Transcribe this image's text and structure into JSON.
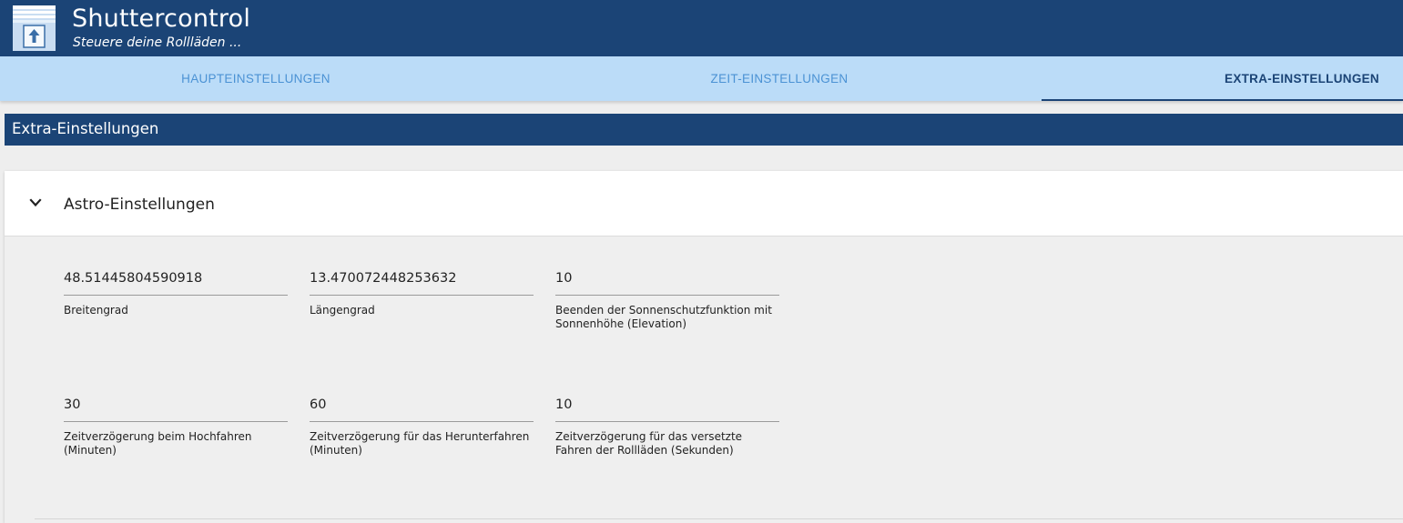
{
  "header": {
    "title": "Shuttercontrol",
    "subtitle": "Steuere deine Rollläden ..."
  },
  "tabs": [
    {
      "label": "HAUPTEINSTELLUNGEN",
      "active": false
    },
    {
      "label": "ZEIT-EINSTELLUNGEN",
      "active": false
    },
    {
      "label": "EXTRA-EINSTELLUNGEN",
      "active": true
    }
  ],
  "section": {
    "title": "Extra-Einstellungen"
  },
  "panel": {
    "title": "Astro-Einstellungen",
    "expanded": true,
    "fields": [
      {
        "value": "48.51445804590918",
        "label": "Breitengrad"
      },
      {
        "value": "13.470072448253632",
        "label": "Längengrad"
      },
      {
        "value": "10",
        "label": "Beenden der Sonnenschutzfunktion mit Sonnenhöhe (Elevation)"
      },
      {
        "value": "30",
        "label": "Zeitverzögerung beim Hochfahren (Minuten)"
      },
      {
        "value": "60",
        "label": "Zeitverzögerung für das Herunterfahren (Minuten)"
      },
      {
        "value": "10",
        "label": "Zeitverzögerung für das versetzte Fahren der Rollläden (Sekunden)"
      }
    ]
  },
  "colors": {
    "primary": "#1b4476",
    "tabbar": "#bbdcf8",
    "tab_inactive_text": "#4b92d4",
    "background": "#eeeeee"
  }
}
